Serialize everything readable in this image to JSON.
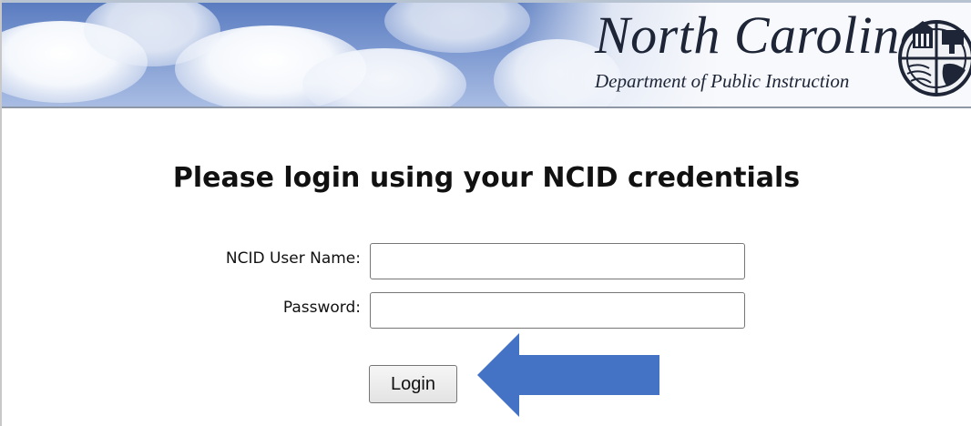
{
  "banner": {
    "title": "North Carolina",
    "subtitle": "Department of Public Instruction",
    "seal_icon": "nc-dpi-seal-icon",
    "sky_color": "#6f8fce"
  },
  "login": {
    "heading": "Please login using your NCID credentials",
    "username_label": "NCID User Name:",
    "username_value": "",
    "password_label": "Password:",
    "password_value": "",
    "button_label": "Login"
  },
  "annotation": {
    "arrow_icon": "left-arrow-icon",
    "arrow_color": "#4472c4"
  }
}
